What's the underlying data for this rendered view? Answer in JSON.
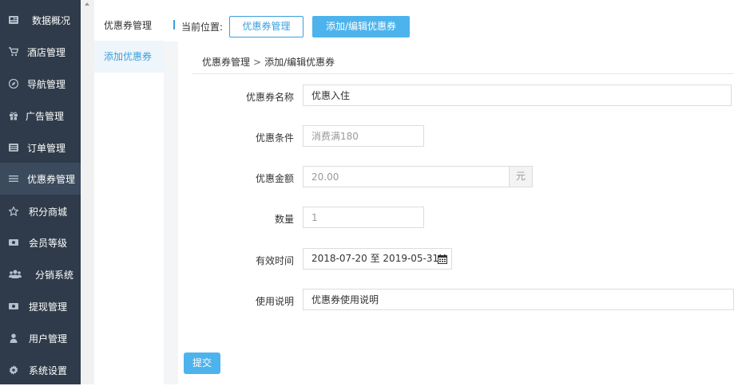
{
  "sidebar": {
    "items": [
      {
        "label": "数据概况",
        "icon": "newspaper-icon"
      },
      {
        "label": "酒店管理",
        "icon": "cart-icon"
      },
      {
        "label": "导航管理",
        "icon": "compass-icon"
      },
      {
        "label": "广告管理",
        "icon": "gift-icon"
      },
      {
        "label": "订单管理",
        "icon": "list-box-icon"
      },
      {
        "label": "优惠券管理",
        "icon": "menu-icon"
      },
      {
        "label": "积分商城",
        "icon": "star-icon"
      },
      {
        "label": "会员等级",
        "icon": "money-icon"
      },
      {
        "label": "分销系统",
        "icon": "users-icon"
      },
      {
        "label": "提现管理",
        "icon": "money-icon"
      },
      {
        "label": "用户管理",
        "icon": "user-icon"
      },
      {
        "label": "系统设置",
        "icon": "gear-icon"
      }
    ],
    "active_index": 5
  },
  "subnav": {
    "items": [
      {
        "label": "优惠券管理"
      },
      {
        "label": "添加优惠券"
      }
    ],
    "active_index": 1
  },
  "topbar": {
    "location_label": "当前位置:",
    "btn_manage": "优惠券管理",
    "btn_edit": "添加/编辑优惠券"
  },
  "breadcrumb": {
    "parent": "优惠券管理",
    "separator": ">",
    "current": "添加/编辑优惠券"
  },
  "form": {
    "name": {
      "label": "优惠券名称",
      "value": "优惠入住"
    },
    "condition": {
      "label": "优惠条件",
      "placeholder": "消费满180"
    },
    "amount": {
      "label": "优惠金额",
      "placeholder": "20.00",
      "unit": "元"
    },
    "quantity": {
      "label": "数量",
      "placeholder": "1"
    },
    "valid_time": {
      "label": "有效时间",
      "start": "2018-07-20",
      "sep": "至",
      "end": "2019-05-31"
    },
    "description": {
      "label": "使用说明",
      "value": "优惠券使用说明"
    },
    "submit_label": "提交"
  },
  "colors": {
    "sidebar_bg": "#2f3b4a",
    "sidebar_active": "#3b4a5c",
    "accent": "#3aa0de",
    "button": "#4db3ec"
  }
}
